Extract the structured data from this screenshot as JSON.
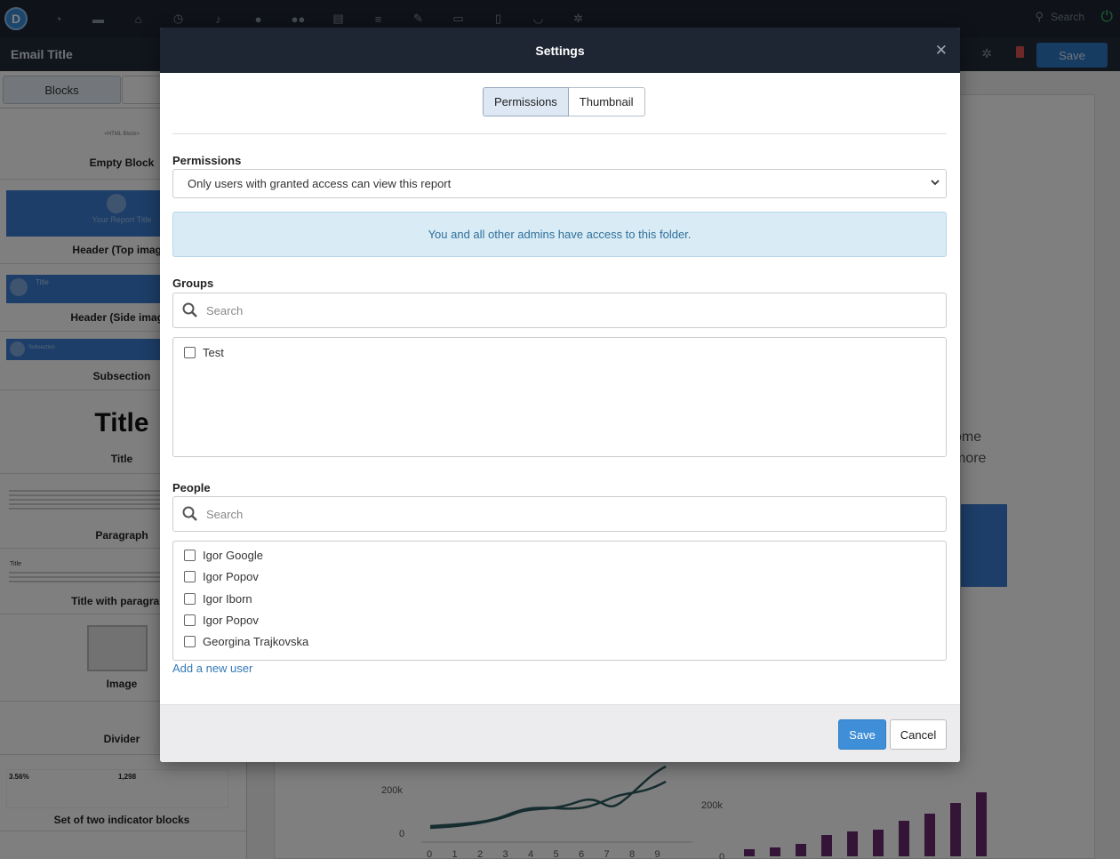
{
  "topnav": {
    "logo_letter": "D",
    "icons": [
      "dashboard-icon",
      "folder-icon",
      "home-icon",
      "clock-icon",
      "bell-icon",
      "user-icon",
      "users-icon",
      "briefcase-icon",
      "database-icon",
      "pencil-icon",
      "monitor-icon",
      "book-icon",
      "headset-icon",
      "settings-icon"
    ],
    "search_placeholder": "Search"
  },
  "subbar": {
    "title": "Email Title",
    "save_label": "Save"
  },
  "sidebar": {
    "tab_blocks": "Blocks",
    "blocks": [
      {
        "label": "Empty Block",
        "preview": "<HTML Block>"
      },
      {
        "label": "Header (Top image)",
        "preview": "Your Report Title"
      },
      {
        "label": "Header (Side image)",
        "preview": "Title"
      },
      {
        "label": "Subsection",
        "preview": "Subsection"
      },
      {
        "label": "Title",
        "preview": "Title"
      },
      {
        "label": "Paragraph"
      },
      {
        "label": "Title with paragraph",
        "preview": "Title"
      },
      {
        "label": "Image"
      },
      {
        "label": "Divider"
      },
      {
        "label": "Set of two indicator blocks",
        "preview_values": [
          "3.56%",
          "1,298"
        ]
      }
    ]
  },
  "canvas": {
    "fragments": [
      "ome",
      "more"
    ],
    "line_chart": {
      "type": "line",
      "y_ticks": [
        "200k",
        "0"
      ],
      "x_ticks": [
        "0",
        "1",
        "2",
        "3",
        "4",
        "5",
        "6",
        "7",
        "8",
        "9"
      ]
    },
    "bar_chart": {
      "type": "bar",
      "y_ticks": [
        "200k",
        "0"
      ]
    }
  },
  "modal": {
    "title": "Settings",
    "tabs": [
      {
        "label": "Permissions",
        "active": true
      },
      {
        "label": "Thumbnail",
        "active": false
      }
    ],
    "permissions_label": "Permissions",
    "permissions_value": "Only users with granted access can view this report",
    "alert": "You and all other admins have access to this folder.",
    "groups_label": "Groups",
    "groups_search_placeholder": "Search",
    "groups": [
      {
        "name": "Test",
        "checked": false
      }
    ],
    "people_label": "People",
    "people_search_placeholder": "Search",
    "people": [
      {
        "name": "Igor Google",
        "checked": false
      },
      {
        "name": "Igor Popov",
        "checked": false
      },
      {
        "name": "Igor Iborn",
        "checked": false
      },
      {
        "name": "Igor Popov",
        "checked": false
      },
      {
        "name": "Georgina Trajkovska",
        "checked": false
      }
    ],
    "add_user_label": "Add a new user",
    "save_label": "Save",
    "cancel_label": "Cancel"
  },
  "colors": {
    "primary": "#3f8fd8",
    "header": "#1f2633",
    "alert_bg": "#d9ebf5",
    "alert_text": "#30709a",
    "power": "#35c06b"
  }
}
